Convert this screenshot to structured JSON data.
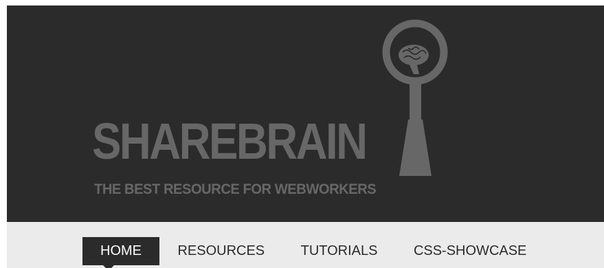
{
  "header": {
    "logo_text": "SHAREBRAIN",
    "slogan": "THE BEST RESOURCE FOR WEBWORKERS",
    "logo_icon": "magnifier-brain-icon"
  },
  "nav": {
    "items": [
      {
        "label": "HOME",
        "active": true
      },
      {
        "label": "RESOURCES",
        "active": false
      },
      {
        "label": "TUTORIALS",
        "active": false
      },
      {
        "label": "CSS-SHOWCASE",
        "active": false
      }
    ]
  },
  "colors": {
    "header_bg": "#2b2b2b",
    "logo_gray": "#676767",
    "nav_bg": "#ebebeb"
  }
}
